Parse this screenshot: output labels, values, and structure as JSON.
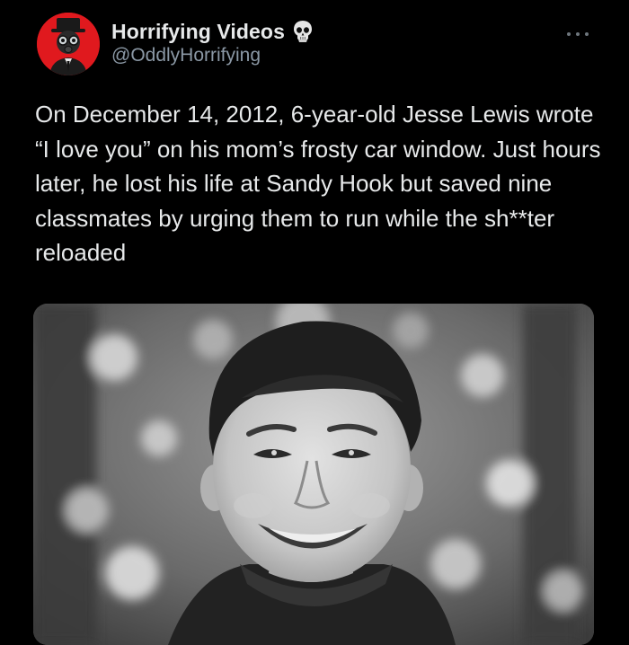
{
  "tweet": {
    "author": {
      "display_name": "Horrifying Videos",
      "handle": "@OddlyHorrifying",
      "badge_icon": "skull-icon",
      "avatar_icon": "gas-mask-figure-icon",
      "avatar_bg": "#e0191e"
    },
    "more_icon": "more-horizontal-icon",
    "text": "On December 14, 2012, 6-year-old Jesse Lewis wrote “I love you” on his mom’s frosty car window. Just hours later, he lost his life at Sandy Hook but saved nine classmates by urging them to run while the sh**ter reloaded",
    "media": {
      "kind": "black-and-white photo of a smiling young boy"
    }
  },
  "colors": {
    "background": "#000000",
    "text_primary": "#e7e9ea",
    "text_secondary": "#8b98a5"
  }
}
